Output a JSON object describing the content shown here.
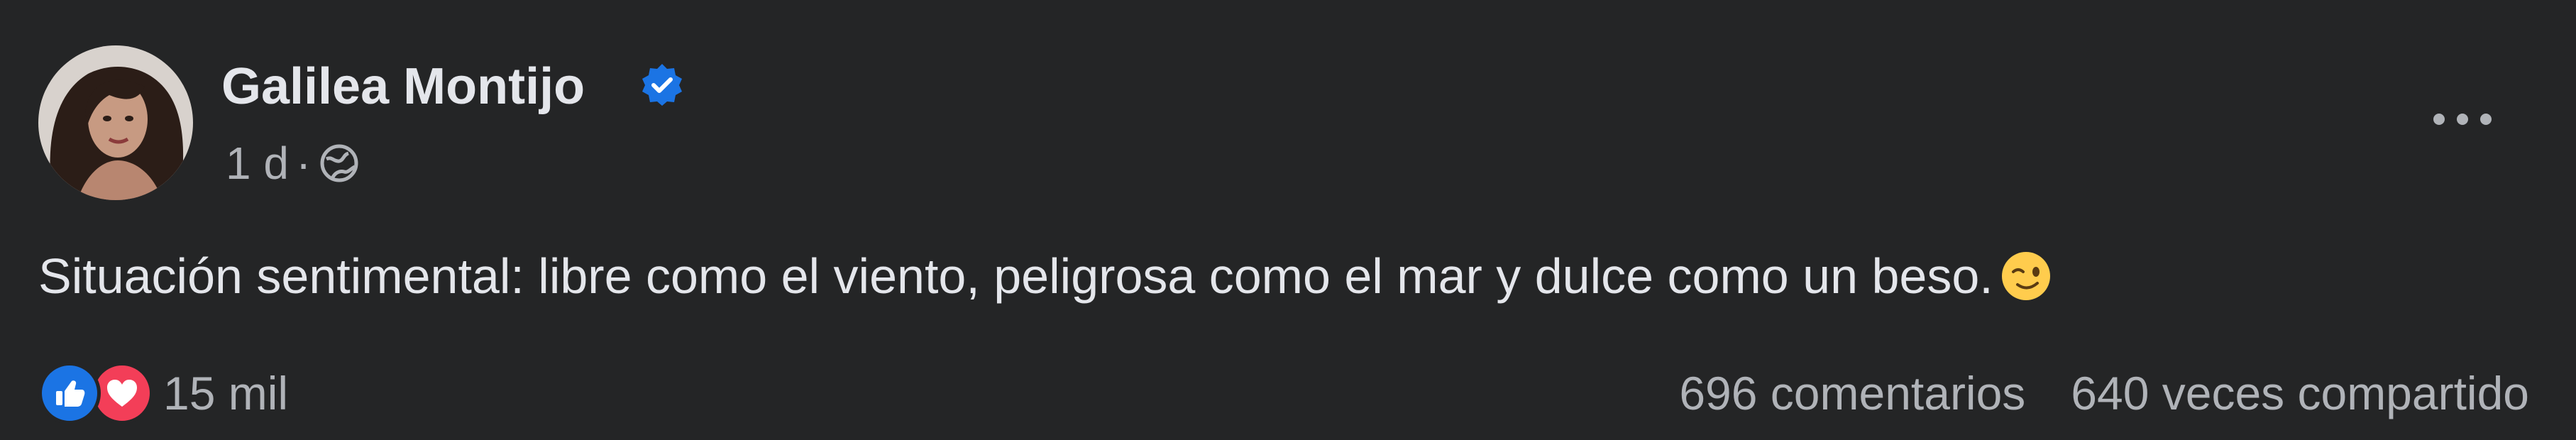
{
  "post": {
    "author_name": "Galilea Montijo",
    "time": "1 d",
    "separator": "·",
    "text": "Situación sentimental: libre como el viento, peligrosa como el mar y dulce como un beso.",
    "reactions_count": "15 mil",
    "comments_count": "696 comentarios",
    "shares_count": "640 veces compartido"
  },
  "icons": {
    "verified": "verified-badge-icon",
    "audience": "globe-icon",
    "more": "more-options-icon",
    "emoji": "winking-face-icon",
    "like": "like-icon",
    "love": "love-icon"
  },
  "colors": {
    "background": "#242526",
    "primary_text": "#e4e6eb",
    "secondary_text": "#b0b3b8",
    "verified_blue": "#1b74e4",
    "love_red": "#f33e58"
  }
}
